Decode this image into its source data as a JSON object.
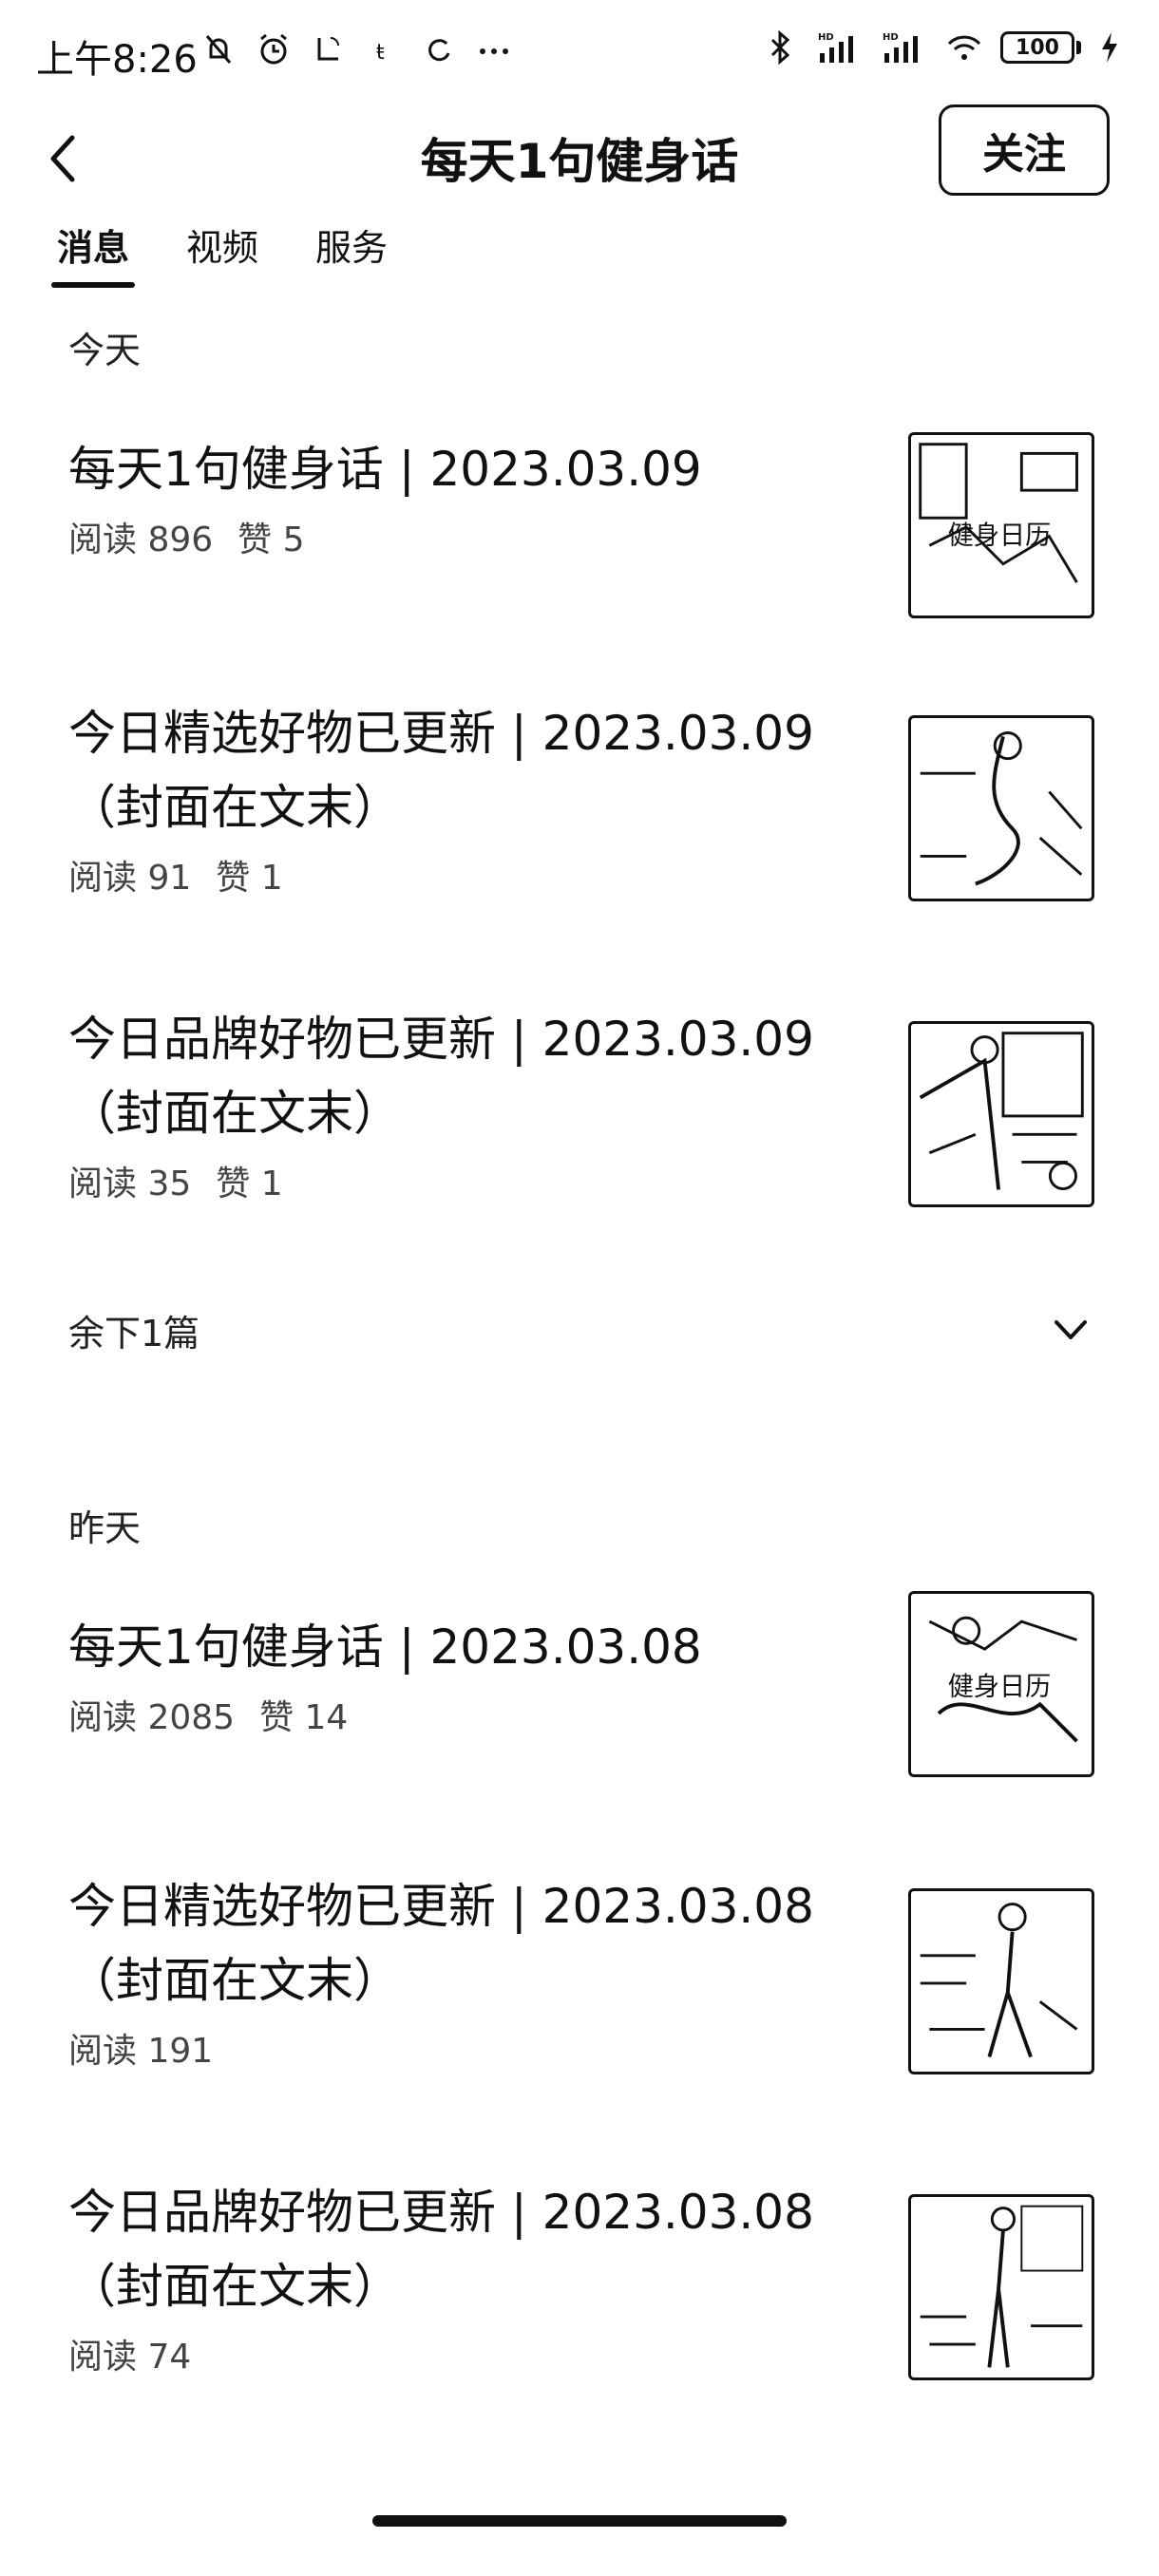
{
  "status_bar": {
    "time": "上午8:26",
    "battery": "100"
  },
  "nav": {
    "title": "每天1句健身话",
    "follow_label": "关注"
  },
  "tabs": [
    {
      "label": "消息",
      "active": true
    },
    {
      "label": "视频",
      "active": false
    },
    {
      "label": "服务",
      "active": false
    }
  ],
  "sections": {
    "today_label": "今天",
    "yesterday_label": "昨天",
    "more_label": "余下1篇"
  },
  "articles_today": [
    {
      "title": "每天1句健身话 | 2023.03.09",
      "reads": "阅读 896",
      "likes": "赞 5"
    },
    {
      "title": "今日精选好物已更新 | 2023.03.09（封面在文末）",
      "reads": "阅读 91",
      "likes": "赞 1"
    },
    {
      "title": "今日品牌好物已更新 | 2023.03.09（封面在文末）",
      "reads": "阅读 35",
      "likes": "赞 1"
    }
  ],
  "articles_yesterday": [
    {
      "title": "每天1句健身话 | 2023.03.08",
      "reads": "阅读 2085",
      "likes": "赞 14"
    },
    {
      "title": "今日精选好物已更新 | 2023.03.08（封面在文末）",
      "reads": "阅读 191",
      "likes": ""
    },
    {
      "title": "今日品牌好物已更新 | 2023.03.08（封面在文末）",
      "reads": "阅读 74",
      "likes": ""
    }
  ],
  "thumbnails": {
    "calendar_text": "健身日历"
  },
  "icons": {
    "back": "chevron-left-icon",
    "expand": "chevron-down-icon"
  }
}
